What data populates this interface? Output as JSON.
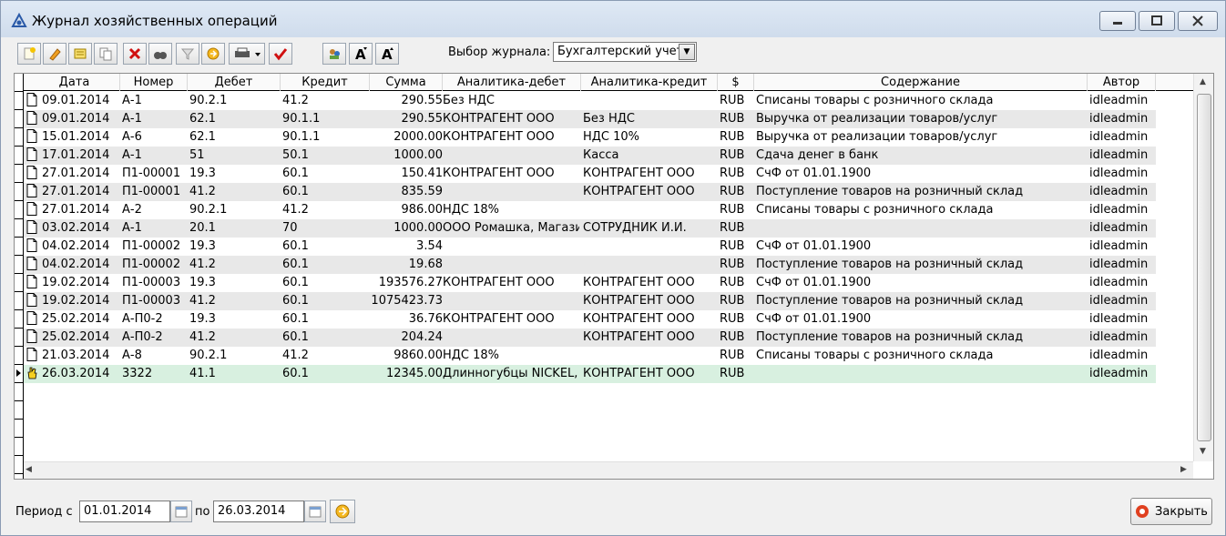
{
  "window": {
    "title": "Журнал хозяйственных операций"
  },
  "toolbar": {
    "journal_label": "Выбор журнала:",
    "journal_value": "Бухгалтерский учет",
    "buttons": [
      "add-icon",
      "edit-icon",
      "note-icon",
      "copy-icon",
      "delete-icon",
      "find-icon",
      "filter-icon",
      "refresh-icon",
      "print-icon",
      "check-icon",
      "people-icon",
      "font-bigger-icon",
      "font-smaller-icon"
    ]
  },
  "table": {
    "columns": [
      "Дата",
      "Номер",
      "Дебет",
      "Кредит",
      "Сумма",
      "Аналитика-дебет",
      "Аналитика-кредит",
      "$",
      "Содержание",
      "Автор"
    ],
    "rows": [
      [
        "09.01.2014",
        "А-1",
        "90.2.1",
        "41.2",
        "290.55",
        "Без НДС",
        "",
        "RUB",
        "Списаны товары с розничного склада",
        "idleadmin"
      ],
      [
        "09.01.2014",
        "А-1",
        "62.1",
        "90.1.1",
        "290.55",
        "КОНТРАГЕНТ ООО",
        "Без НДС",
        "RUB",
        "Выручка от реализации товаров/услуг",
        "idleadmin"
      ],
      [
        "15.01.2014",
        "А-6",
        "62.1",
        "90.1.1",
        "2000.00",
        "КОНТРАГЕНТ ООО",
        "НДС 10%",
        "RUB",
        "Выручка от реализации товаров/услуг",
        "idleadmin"
      ],
      [
        "17.01.2014",
        "А-1",
        "51",
        "50.1",
        "1000.00",
        "",
        "Касса",
        "RUB",
        "Сдача денег в банк",
        "idleadmin"
      ],
      [
        "27.01.2014",
        "П1-00001",
        "19.3",
        "60.1",
        "150.41",
        "КОНТРАГЕНТ ООО",
        "КОНТРАГЕНТ ООО",
        "RUB",
        "СчФ  от 01.01.1900",
        "idleadmin"
      ],
      [
        "27.01.2014",
        "П1-00001",
        "41.2",
        "60.1",
        "835.59",
        "",
        "КОНТРАГЕНТ ООО",
        "RUB",
        "Поступление товаров на розничный склад",
        "idleadmin"
      ],
      [
        "27.01.2014",
        "А-2",
        "90.2.1",
        "41.2",
        "986.00",
        "НДС 18%",
        "",
        "RUB",
        "Списаны товары с розничного склада",
        "idleadmin"
      ],
      [
        "03.02.2014",
        "А-1",
        "20.1",
        "70",
        "1000.00",
        "ООО Ромашка, Магази",
        "СОТРУДНИК И.И.",
        "RUB",
        "",
        "idleadmin"
      ],
      [
        "04.02.2014",
        "П1-00002",
        "19.3",
        "60.1",
        "3.54",
        "",
        "",
        "RUB",
        "СчФ  от 01.01.1900",
        "idleadmin"
      ],
      [
        "04.02.2014",
        "П1-00002",
        "41.2",
        "60.1",
        "19.68",
        "",
        "",
        "RUB",
        "Поступление товаров на розничный склад",
        "idleadmin"
      ],
      [
        "19.02.2014",
        "П1-00003",
        "19.3",
        "60.1",
        "193576.27",
        "КОНТРАГЕНТ ООО",
        "КОНТРАГЕНТ ООО",
        "RUB",
        "СчФ  от 01.01.1900",
        "idleadmin"
      ],
      [
        "19.02.2014",
        "П1-00003",
        "41.2",
        "60.1",
        "1075423.73",
        "",
        "КОНТРАГЕНТ ООО",
        "RUB",
        "Поступление товаров на розничный склад",
        "idleadmin"
      ],
      [
        "25.02.2014",
        "А-П0-2",
        "19.3",
        "60.1",
        "36.76",
        "КОНТРАГЕНТ ООО",
        "КОНТРАГЕНТ ООО",
        "RUB",
        "СчФ  от 01.01.1900",
        "idleadmin"
      ],
      [
        "25.02.2014",
        "А-П0-2",
        "41.2",
        "60.1",
        "204.24",
        "",
        "КОНТРАГЕНТ ООО",
        "RUB",
        "Поступление товаров на розничный склад",
        "idleadmin"
      ],
      [
        "21.03.2014",
        "А-8",
        "90.2.1",
        "41.2",
        "9860.00",
        "НДС 18%",
        "",
        "RUB",
        "Списаны товары с розничного склада",
        "idleadmin"
      ],
      [
        "26.03.2014",
        "3322",
        "41.1",
        "60.1",
        "12345.00",
        "Длинногубцы NICKEL,",
        "КОНТРАГЕНТ ООО",
        "RUB",
        "",
        "idleadmin"
      ]
    ],
    "selected_row": 15
  },
  "footer": {
    "period_label": "Период с",
    "date_from": "01.01.2014",
    "to_label": "по",
    "date_to": "26.03.2014",
    "close_label": "Закрыть"
  }
}
